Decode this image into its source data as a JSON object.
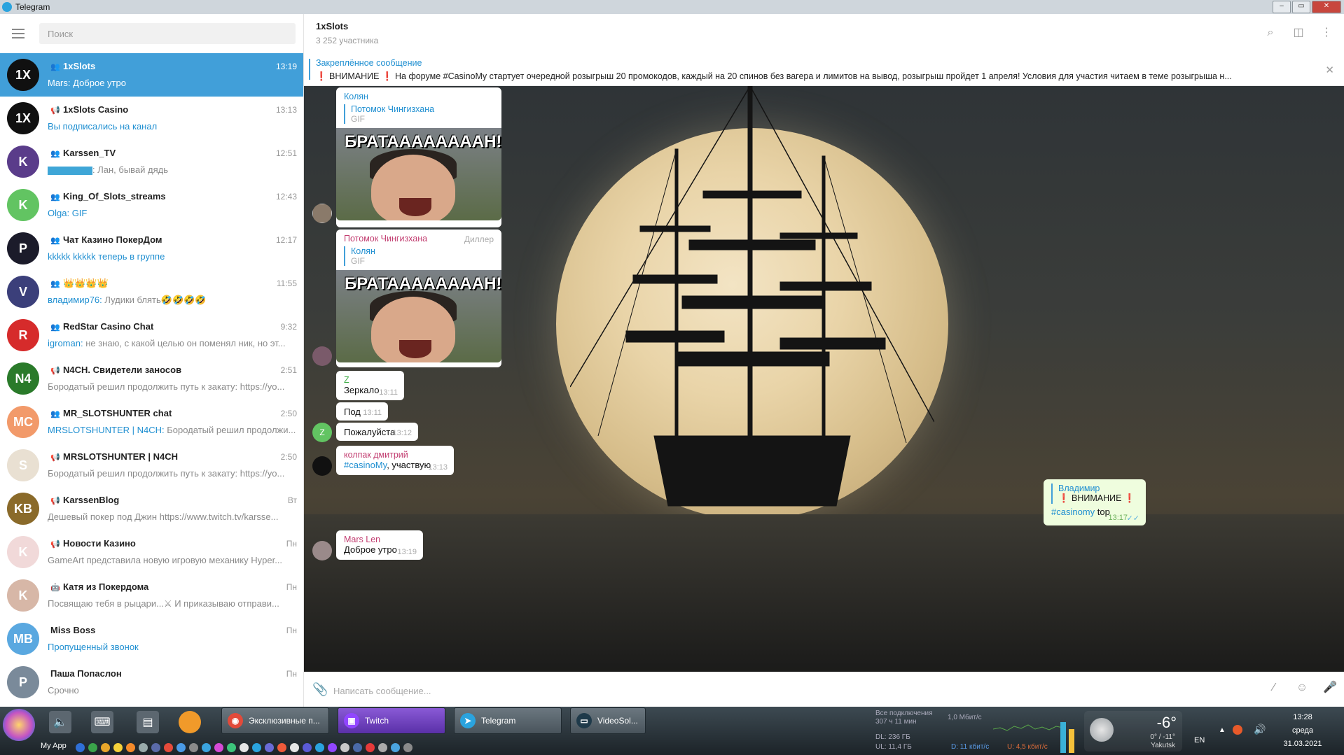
{
  "window": {
    "title": "Telegram"
  },
  "search": {
    "placeholder": "Поиск"
  },
  "chats": [
    {
      "name": "1xSlots",
      "time": "13:19",
      "sender": "Mars: ",
      "preview": "Доброе утро",
      "type": "group",
      "active": true,
      "avatar_text": "1X",
      "avatar_color": "#101010"
    },
    {
      "name": "1xSlots Casino",
      "time": "13:13",
      "sender": "",
      "preview": "Вы подписались на канал",
      "preview_blue": true,
      "type": "channel",
      "avatar_text": "1X",
      "avatar_color": "#101010"
    },
    {
      "name": "Karssen_TV",
      "time": "12:51",
      "sender": "",
      "preview": ": Лан, бывай дядь",
      "type": "group",
      "blank_sender": true,
      "avatar_text": "K",
      "avatar_color": "#5a3c8a"
    },
    {
      "name": "King_Of_Slots_streams",
      "time": "12:43",
      "sender": "Olga: ",
      "preview": "GIF",
      "preview_blue": true,
      "type": "group",
      "avatar_text": "K",
      "avatar_color": "#62c462"
    },
    {
      "name": "Чат Казино ПокерДом",
      "time": "12:17",
      "sender": "",
      "preview": "kkkkk kkkkk теперь в группе",
      "preview_blue": true,
      "type": "group",
      "avatar_text": "P",
      "avatar_color": "#1b1b2a"
    },
    {
      "name": "👑👑👑👑",
      "time": "11:55",
      "sender": "владимир76: ",
      "preview": "Лудики блять🤣🤣🤣🤣",
      "type": "group",
      "avatar_text": "V",
      "avatar_color": "#3b3f7a"
    },
    {
      "name": "RedStar Casino Chat",
      "time": "9:32",
      "sender": "igroman: ",
      "preview": "не знаю, с какой целью он поменял ник, но эт...",
      "type": "group",
      "avatar_text": "R",
      "avatar_color": "#d62b2b"
    },
    {
      "name": "N4CH. Свидетели заносов",
      "time": "2:51",
      "sender": "",
      "preview": "Бородатый решил продолжить путь к закату: https://yo...",
      "type": "channel",
      "avatar_text": "N4",
      "avatar_color": "#2a7a2a"
    },
    {
      "name": "MR_SLOTSHUNTER chat",
      "time": "2:50",
      "sender": "MRSLOTSHUNTER | N4CH: ",
      "preview": "Бородатый решил продолжи...",
      "type": "group",
      "avatar_text": "MC",
      "avatar_color": "#f29a6a"
    },
    {
      "name": "MRSLOTSHUNTER | N4CH",
      "time": "2:50",
      "sender": "",
      "preview": "Бородатый решил продолжить путь к закату: https://yo...",
      "type": "channel",
      "avatar_text": "S",
      "avatar_color": "#e9e0d2"
    },
    {
      "name": "KarssenBlog",
      "time": "Вт",
      "sender": "",
      "preview": "Дешевый покер под Джин https://www.twitch.tv/karsse...",
      "type": "channel",
      "avatar_text": "KB",
      "avatar_color": "#8a6a2a"
    },
    {
      "name": "Новости Казино",
      "time": "Пн",
      "sender": "",
      "preview": "GameArt представила новую игровую механику Hyper...",
      "type": "channel",
      "avatar_text": "K",
      "avatar_color": "#f1d9d9"
    },
    {
      "name": "Катя из Покердома",
      "time": "Пн",
      "sender": "",
      "preview": "Посвящаю тебя в рыцари...⚔ И приказываю отправи...",
      "type": "bot",
      "avatar_text": "K",
      "avatar_color": "#d7b7a7"
    },
    {
      "name": "Miss Boss",
      "time": "Пн",
      "sender": "",
      "preview": "Пропущенный звонок",
      "preview_blue": true,
      "type": "none",
      "avatar_text": "MB",
      "avatar_color": "#5aa8e0"
    },
    {
      "name": "Паша Попаслон",
      "time": "Пн",
      "sender": "",
      "preview": "Срочно",
      "type": "none",
      "avatar_text": "P",
      "avatar_color": "#7a8a9a"
    }
  ],
  "header": {
    "title": "1xSlots",
    "subtitle": "3 252 участника"
  },
  "pinned": {
    "title": "Закреплённое сообщение",
    "text": "❗ ВНИМАНИЕ ❗  На форуме #CasinoMy стартует очередной розыгрыш 20 промокодов, каждый на 20 спинов без вагера и лимитов на вывод, розыгрыш пройдет 1 апреля!  Условия для участия читаем в теме розыгрыша н..."
  },
  "messages": {
    "m1": {
      "author": "Колян",
      "reply_name": "Потомок Чингизхана",
      "reply_sub": "GIF",
      "gif_caption": "БРАТААААААААН!!!!"
    },
    "m2": {
      "author": "Потомок Чингизхана",
      "badge": "Диллер",
      "reply_name": "Колян",
      "reply_sub": "GIF",
      "gif_caption": "БРАТААААААААН!!!!"
    },
    "m3": {
      "author": "Z",
      "text": "Зеркало",
      "time": "13:11"
    },
    "m4": {
      "text": "Под",
      "time": "13:11"
    },
    "m5": {
      "text": "Пожалуйста",
      "time": "13:12",
      "avatar": "Z"
    },
    "m6": {
      "author": "колпак дмитрий",
      "hashtag": "#casinoMy",
      "text": ", участвую",
      "time": "13:13"
    },
    "m7": {
      "author": "Mars Len",
      "text": "Доброе утро",
      "time": "13:19"
    },
    "out": {
      "reply_name": "Владимир",
      "reply_text": "❗ ВНИМАНИЕ ❗  На...",
      "hashtag": "#casinomy",
      "text": " top",
      "time": "13:17"
    }
  },
  "composer": {
    "placeholder": "Написать сообщение..."
  },
  "taskbar": {
    "start_label": "My App",
    "buttons": [
      {
        "label": "Эксклюзивные п...",
        "icon_color": "#e24a3a",
        "kind": "chrome"
      },
      {
        "label": "Twitch",
        "icon_color": "#9146ff",
        "kind": "twitch"
      },
      {
        "label": "Telegram",
        "icon_color": "#2aa3de",
        "kind": "telegram"
      },
      {
        "label": "VideoSol...",
        "icon_color": "#1f3a4a",
        "kind": "video"
      }
    ],
    "net": {
      "label": "Все подключения",
      "uptime": "307 ч 11 мин",
      "speed": "1,0 Мбит/с",
      "dl_total": "DL: 236 ГБ",
      "ul_total": "UL: 11,4 ГБ",
      "dl_rate": "D: 11 кбит/с",
      "ul_rate": "U: 4,5 кбит/с"
    },
    "weather": {
      "temp": "-6°",
      "range": "0° / -11°",
      "city": "Yakutsk"
    },
    "lang": "EN",
    "clock": {
      "time": "13:28",
      "day": "среда",
      "date": "31.03.2021"
    }
  }
}
